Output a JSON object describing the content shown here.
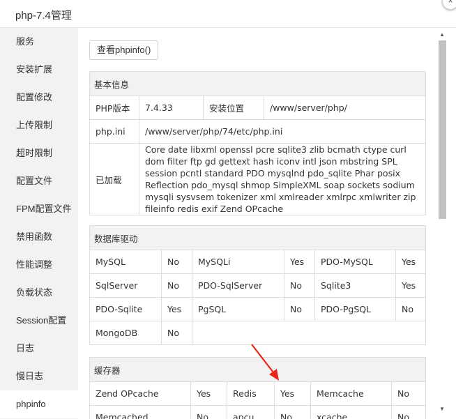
{
  "window": {
    "title": "php-7.4管理",
    "close_icon": "×"
  },
  "sidebar": {
    "items": [
      {
        "label": "服务"
      },
      {
        "label": "安装扩展"
      },
      {
        "label": "配置修改"
      },
      {
        "label": "上传限制"
      },
      {
        "label": "超时限制"
      },
      {
        "label": "配置文件"
      },
      {
        "label": "FPM配置文件"
      },
      {
        "label": "禁用函数"
      },
      {
        "label": "性能调整"
      },
      {
        "label": "负载状态"
      },
      {
        "label": "Session配置"
      },
      {
        "label": "日志"
      },
      {
        "label": "慢日志"
      },
      {
        "label": "phpinfo"
      }
    ],
    "active_index": 13
  },
  "main": {
    "phpinfo_button": "查看phpinfo()",
    "basic": {
      "title": "基本信息",
      "version_label": "PHP版本",
      "version_value": "7.4.33",
      "install_label": "安装位置",
      "install_value": "/www/server/php/",
      "ini_label": "php.ini",
      "ini_value": "/www/server/php/74/etc/php.ini",
      "loaded_label": "已加载",
      "loaded_value": "Core date libxml openssl pcre sqlite3 zlib bcmath ctype curl dom filter ftp gd gettext hash iconv intl json mbstring SPL session pcntl standard PDO mysqlnd pdo_sqlite Phar posix Reflection pdo_mysql shmop SimpleXML soap sockets sodium mysqli sysvsem tokenizer xml xmlreader xmlrpc xmlwriter zip fileinfo redis exif Zend OPcache"
    },
    "db": {
      "title": "数据库驱动",
      "rows": [
        [
          {
            "name": "MySQL",
            "status": "No"
          },
          {
            "name": "MySQLi",
            "status": "Yes"
          },
          {
            "name": "PDO-MySQL",
            "status": "Yes"
          }
        ],
        [
          {
            "name": "SqlServer",
            "status": "No"
          },
          {
            "name": "PDO-SqlServer",
            "status": "No"
          },
          {
            "name": "Sqlite3",
            "status": "Yes"
          }
        ],
        [
          {
            "name": "PDO-Sqlite",
            "status": "Yes"
          },
          {
            "name": "PgSQL",
            "status": "No"
          },
          {
            "name": "PDO-PgSQL",
            "status": "No"
          }
        ],
        [
          {
            "name": "MongoDB",
            "status": "No"
          }
        ]
      ]
    },
    "cache": {
      "title": "缓存器",
      "rows": [
        [
          {
            "name": "Zend OPcache",
            "status": "Yes"
          },
          {
            "name": "Redis",
            "status": "Yes"
          },
          {
            "name": "Memcache",
            "status": "No"
          }
        ],
        [
          {
            "name": "Memcached",
            "status": "No"
          },
          {
            "name": "apcu",
            "status": "No"
          },
          {
            "name": "xcache",
            "status": "No"
          }
        ]
      ]
    }
  },
  "colors": {
    "yes": "#1b7d1b",
    "no": "#e02020",
    "annotation_arrow": "#e8261c"
  }
}
